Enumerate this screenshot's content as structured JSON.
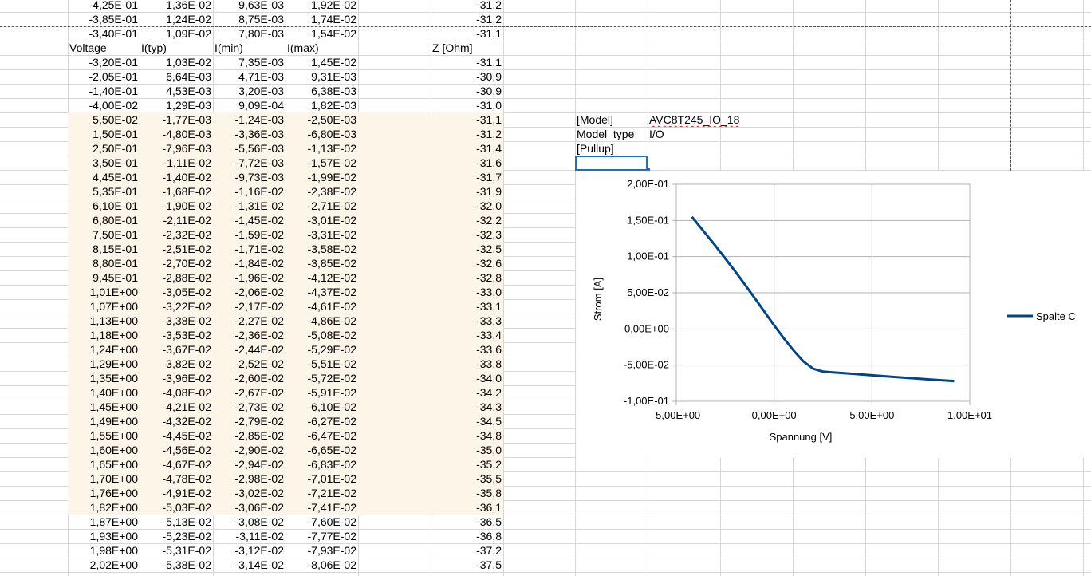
{
  "sheet": {
    "rows_top": [
      {
        "a": "-4,25E-01",
        "b": "1,36E-02",
        "c": "9,63E-03",
        "d": "1,92E-02",
        "z": "-31,2"
      },
      {
        "a": "-3,85E-01",
        "b": "1,24E-02",
        "c": "8,75E-03",
        "d": "1,74E-02",
        "z": "-31,2"
      },
      {
        "a": "-3,40E-01",
        "b": "1,09E-02",
        "c": "7,80E-03",
        "d": "1,54E-02",
        "z": "-31,1"
      }
    ],
    "header": {
      "a": "Voltage",
      "b": "I(typ)",
      "c": "I(min)",
      "d": "I(max)",
      "z": "Z [Ohm]"
    },
    "rows": [
      {
        "a": "-3,20E-01",
        "b": "1,03E-02",
        "c": "7,35E-03",
        "d": "1,45E-02",
        "z": "-31,1"
      },
      {
        "a": "-2,05E-01",
        "b": "6,64E-03",
        "c": "4,71E-03",
        "d": "9,31E-03",
        "z": "-30,9"
      },
      {
        "a": "-1,40E-01",
        "b": "4,53E-03",
        "c": "3,20E-03",
        "d": "6,38E-03",
        "z": "-30,9"
      },
      {
        "a": "-4,00E-02",
        "b": "1,29E-03",
        "c": "9,09E-04",
        "d": "1,82E-03",
        "z": "-31,0"
      },
      {
        "a": "5,50E-02",
        "b": "-1,77E-03",
        "c": "-1,24E-03",
        "d": "-2,50E-03",
        "z": "-31,1"
      },
      {
        "a": "1,50E-01",
        "b": "-4,80E-03",
        "c": "-3,36E-03",
        "d": "-6,80E-03",
        "z": "-31,2"
      },
      {
        "a": "2,50E-01",
        "b": "-7,96E-03",
        "c": "-5,56E-03",
        "d": "-1,13E-02",
        "z": "-31,4"
      },
      {
        "a": "3,50E-01",
        "b": "-1,11E-02",
        "c": "-7,72E-03",
        "d": "-1,57E-02",
        "z": "-31,6"
      },
      {
        "a": "4,45E-01",
        "b": "-1,40E-02",
        "c": "-9,73E-03",
        "d": "-1,99E-02",
        "z": "-31,7"
      },
      {
        "a": "5,35E-01",
        "b": "-1,68E-02",
        "c": "-1,16E-02",
        "d": "-2,38E-02",
        "z": "-31,9"
      },
      {
        "a": "6,10E-01",
        "b": "-1,90E-02",
        "c": "-1,31E-02",
        "d": "-2,71E-02",
        "z": "-32,0"
      },
      {
        "a": "6,80E-01",
        "b": "-2,11E-02",
        "c": "-1,45E-02",
        "d": "-3,01E-02",
        "z": "-32,2"
      },
      {
        "a": "7,50E-01",
        "b": "-2,32E-02",
        "c": "-1,59E-02",
        "d": "-3,31E-02",
        "z": "-32,3"
      },
      {
        "a": "8,15E-01",
        "b": "-2,51E-02",
        "c": "-1,71E-02",
        "d": "-3,58E-02",
        "z": "-32,5"
      },
      {
        "a": "8,80E-01",
        "b": "-2,70E-02",
        "c": "-1,84E-02",
        "d": "-3,85E-02",
        "z": "-32,6"
      },
      {
        "a": "9,45E-01",
        "b": "-2,88E-02",
        "c": "-1,96E-02",
        "d": "-4,12E-02",
        "z": "-32,8"
      },
      {
        "a": "1,01E+00",
        "b": "-3,05E-02",
        "c": "-2,06E-02",
        "d": "-4,37E-02",
        "z": "-33,0"
      },
      {
        "a": "1,07E+00",
        "b": "-3,22E-02",
        "c": "-2,17E-02",
        "d": "-4,61E-02",
        "z": "-33,1"
      },
      {
        "a": "1,13E+00",
        "b": "-3,38E-02",
        "c": "-2,27E-02",
        "d": "-4,86E-02",
        "z": "-33,3"
      },
      {
        "a": "1,18E+00",
        "b": "-3,53E-02",
        "c": "-2,36E-02",
        "d": "-5,08E-02",
        "z": "-33,4"
      },
      {
        "a": "1,24E+00",
        "b": "-3,67E-02",
        "c": "-2,44E-02",
        "d": "-5,29E-02",
        "z": "-33,6"
      },
      {
        "a": "1,29E+00",
        "b": "-3,82E-02",
        "c": "-2,52E-02",
        "d": "-5,51E-02",
        "z": "-33,8"
      },
      {
        "a": "1,35E+00",
        "b": "-3,96E-02",
        "c": "-2,60E-02",
        "d": "-5,72E-02",
        "z": "-34,0"
      },
      {
        "a": "1,40E+00",
        "b": "-4,08E-02",
        "c": "-2,67E-02",
        "d": "-5,91E-02",
        "z": "-34,2"
      },
      {
        "a": "1,45E+00",
        "b": "-4,21E-02",
        "c": "-2,73E-02",
        "d": "-6,10E-02",
        "z": "-34,3"
      },
      {
        "a": "1,49E+00",
        "b": "-4,32E-02",
        "c": "-2,79E-02",
        "d": "-6,27E-02",
        "z": "-34,5"
      },
      {
        "a": "1,55E+00",
        "b": "-4,45E-02",
        "c": "-2,85E-02",
        "d": "-6,47E-02",
        "z": "-34,8"
      },
      {
        "a": "1,60E+00",
        "b": "-4,56E-02",
        "c": "-2,90E-02",
        "d": "-6,65E-02",
        "z": "-35,0"
      },
      {
        "a": "1,65E+00",
        "b": "-4,67E-02",
        "c": "-2,94E-02",
        "d": "-6,83E-02",
        "z": "-35,2"
      },
      {
        "a": "1,70E+00",
        "b": "-4,78E-02",
        "c": "-2,98E-02",
        "d": "-7,01E-02",
        "z": "-35,5"
      },
      {
        "a": "1,76E+00",
        "b": "-4,91E-02",
        "c": "-3,02E-02",
        "d": "-7,21E-02",
        "z": "-35,8"
      },
      {
        "a": "1,82E+00",
        "b": "-5,03E-02",
        "c": "-3,06E-02",
        "d": "-7,41E-02",
        "z": "-36,1"
      },
      {
        "a": "1,87E+00",
        "b": "-5,13E-02",
        "c": "-3,08E-02",
        "d": "-7,60E-02",
        "z": "-36,5"
      },
      {
        "a": "1,93E+00",
        "b": "-5,23E-02",
        "c": "-3,11E-02",
        "d": "-7,77E-02",
        "z": "-36,8"
      },
      {
        "a": "1,98E+00",
        "b": "-5,31E-02",
        "c": "-3,12E-02",
        "d": "-7,93E-02",
        "z": "-37,2"
      },
      {
        "a": "2,02E+00",
        "b": "-5,38E-02",
        "c": "-3,14E-02",
        "d": "-8,06E-02",
        "z": "-37,5"
      }
    ]
  },
  "model": {
    "rows": [
      {
        "label": "[Model]",
        "value": "AVC8T245_IO_18"
      },
      {
        "label": "Model_type",
        "value": "I/O"
      },
      {
        "label": "[Pullup]",
        "value": ""
      }
    ]
  },
  "colors": {
    "highlight": "#fdf5e7",
    "series": "#004586",
    "selection": "#1e6fbf"
  },
  "chart_data": {
    "type": "line",
    "title": "",
    "xlabel": "Spannung [V]",
    "ylabel": "Strom [A]",
    "xlim": [
      -5.0,
      10.0
    ],
    "ylim": [
      -0.1,
      0.2
    ],
    "xticks": [
      "-5,00E+00",
      "0,00E+00",
      "5,00E+00",
      "1,00E+01"
    ],
    "yticks": [
      "2,00E-01",
      "1,50E-01",
      "1,00E-01",
      "5,00E-02",
      "0,00E+00",
      "-5,00E-02",
      "-1,00E-01"
    ],
    "grid": true,
    "legend": "right",
    "series": [
      {
        "name": "Spalte C",
        "color": "#004586",
        "points": [
          [
            -4.2,
            0.155
          ],
          [
            -3.0,
            0.115
          ],
          [
            -2.0,
            0.08
          ],
          [
            -1.0,
            0.043
          ],
          [
            0.0,
            0.005
          ],
          [
            0.5,
            -0.013
          ],
          [
            1.0,
            -0.03
          ],
          [
            1.5,
            -0.045
          ],
          [
            2.0,
            -0.055
          ],
          [
            2.5,
            -0.059
          ],
          [
            3.0,
            -0.06
          ],
          [
            4.0,
            -0.062
          ],
          [
            5.0,
            -0.064
          ],
          [
            6.0,
            -0.066
          ],
          [
            7.0,
            -0.068
          ],
          [
            8.0,
            -0.07
          ],
          [
            9.2,
            -0.072
          ]
        ]
      }
    ]
  }
}
